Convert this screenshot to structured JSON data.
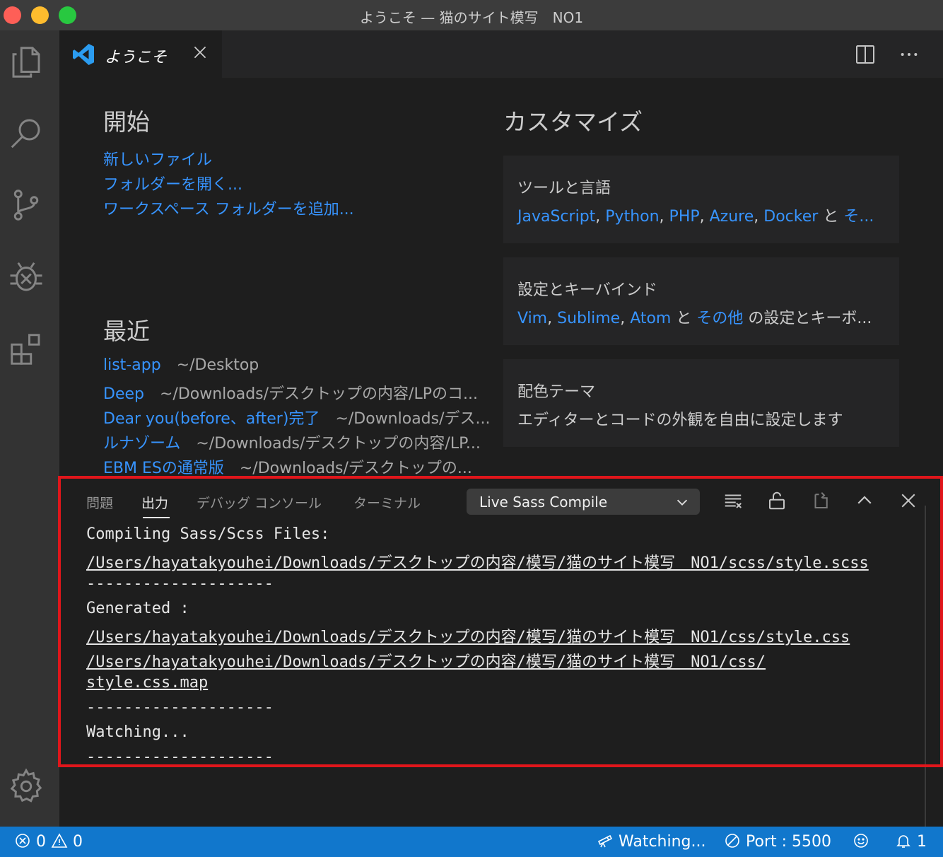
{
  "window": {
    "title": "ようこそ — 猫のサイト模写　NO1"
  },
  "activity_bar": {
    "items": [
      {
        "icon": "files-icon"
      },
      {
        "icon": "search-icon"
      },
      {
        "icon": "source-control-icon"
      },
      {
        "icon": "debug-icon"
      },
      {
        "icon": "extensions-icon"
      }
    ],
    "settings_icon": "gear-icon"
  },
  "editor_tab": {
    "label": "ようこそ"
  },
  "welcome": {
    "start": {
      "heading": "開始",
      "links": [
        "新しいファイル",
        "フォルダーを開く...",
        "ワークスペース フォルダーを追加..."
      ]
    },
    "recent": {
      "heading": "最近",
      "items": [
        {
          "name": "list-app",
          "path": "~/Desktop"
        },
        {
          "name": "Deep",
          "path": "~/Downloads/デスクトップの内容/LPのコ..."
        },
        {
          "name": "Dear you(before、after)完了",
          "path": "~/Downloads/デス..."
        },
        {
          "name": "ルナゾーム",
          "path": "~/Downloads/デスクトップの内容/LP..."
        },
        {
          "name": "EBM ESの通常版",
          "path": "~/Downloads/デスクトップの..."
        }
      ]
    },
    "customize": {
      "heading": "カスタマイズ",
      "tools": {
        "title": "ツールと言語",
        "links": [
          "JavaScript",
          "Python",
          "PHP",
          "Azure",
          "Docker"
        ],
        "separator": ", ",
        "and": "と",
        "more": "そ..."
      },
      "keybindings": {
        "title": "設定とキーバインド",
        "links": [
          "Vim",
          "Sublime",
          "Atom"
        ],
        "and": "と",
        "more": "その他",
        "suffix": "の設定とキーボ..."
      },
      "theme": {
        "title": "配色テーマ",
        "desc": "エディターとコードの外観を自由に設定します"
      }
    }
  },
  "panel": {
    "tabs": [
      "問題",
      "出力",
      "デバッグ コンソール",
      "ターミナル"
    ],
    "active_tab": "出力",
    "dropdown": {
      "selected": "Live Sass Compile"
    },
    "output_lines": [
      {
        "text": "Compiling Sass/Scss Files:",
        "underline": false
      },
      {
        "text": "/Users/hayatakyouhei/Downloads/デスクトップの内容/模写/猫のサイト模写　NO1/scss/style.scss",
        "underline": true
      },
      {
        "text": "--------------------",
        "underline": false
      },
      {
        "text": "Generated :",
        "underline": false
      },
      {
        "text": "/Users/hayatakyouhei/Downloads/デスクトップの内容/模写/猫のサイト模写　NO1/css/style.css",
        "underline": true
      },
      {
        "text": "/Users/hayatakyouhei/Downloads/デスクトップの内容/模写/猫のサイト模写　NO1/css/",
        "underline": true
      },
      {
        "text": "style.css.map",
        "underline": true
      },
      {
        "text": "--------------------",
        "underline": false
      },
      {
        "text": "Watching...",
        "underline": false
      },
      {
        "text": "--------------------",
        "underline": false
      }
    ]
  },
  "status_bar": {
    "errors": "0",
    "warnings": "0",
    "watching": "Watching...",
    "port": "Port : 5500",
    "notifications": "1"
  },
  "colors": {
    "link": "#3794ff",
    "status_bar": "#1177cc",
    "highlight_border": "#e0161b"
  }
}
